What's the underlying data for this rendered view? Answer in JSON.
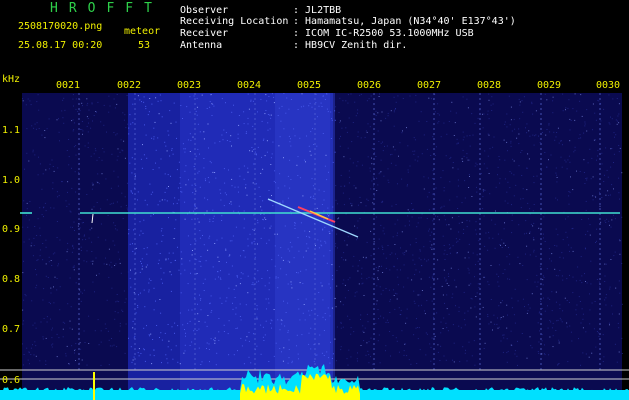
{
  "header": {
    "title": "HROFFT",
    "filename": "2508170020.png",
    "timestamp": "25.08.17 00:20",
    "meteor_label": "meteor",
    "meteor_count": "53",
    "info": [
      {
        "key": "Observer",
        "value": ": JL2TBB"
      },
      {
        "key": "Receiving Location",
        "value": ": Hamamatsu, Japan (N34°40' E137°43')"
      },
      {
        "key": "Receiver",
        "value": ": ICOM IC-R2500 53.1000MHz USB"
      },
      {
        "key": "Antenna",
        "value": ": HB9CV Zenith dir."
      }
    ]
  },
  "axis": {
    "unit": "kHz",
    "y_ticks": [
      "1.1",
      "1.0",
      "0.9",
      "0.8",
      "0.7",
      "0.6"
    ],
    "x_ticks": [
      "0021",
      "0022",
      "0023",
      "0024",
      "0025",
      "0026",
      "0027",
      "0028",
      "0029",
      "0030"
    ]
  },
  "colors": {
    "background": "#000000",
    "noise_base": "#0a0a50",
    "carrier": "#40e0d0",
    "spectrum": "#00e0ff",
    "spectrum_peak": "#ffff00"
  }
}
